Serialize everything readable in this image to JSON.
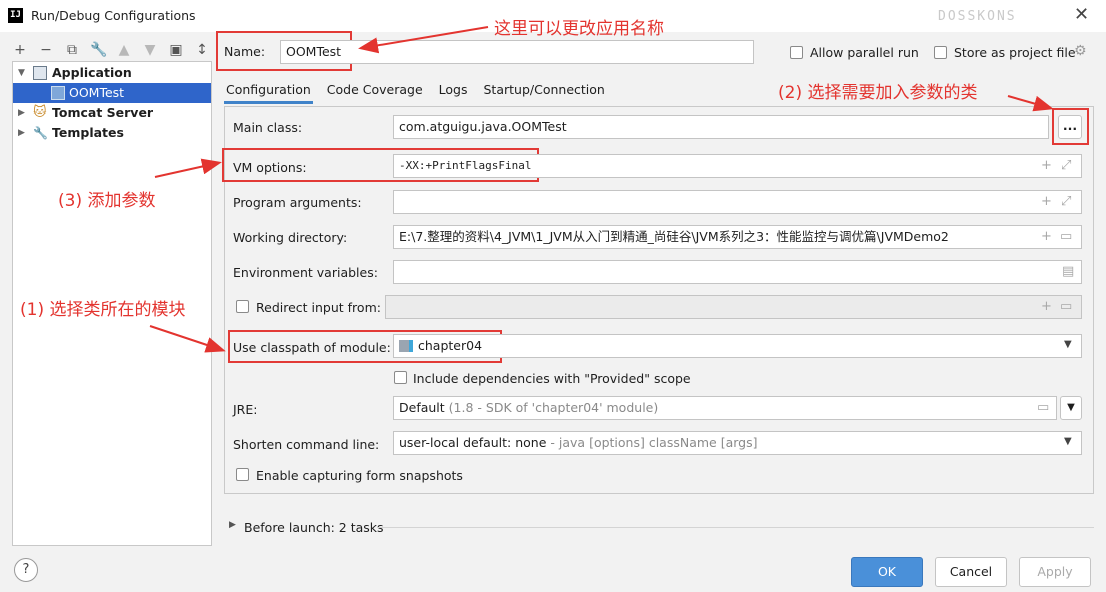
{
  "window": {
    "title": "Run/Debug Configurations",
    "app_icon_text": "IJ",
    "watermark_top": "DOSSKONS"
  },
  "tree": {
    "application": "Application",
    "oomtest": "OOMTest",
    "tomcat": "Tomcat Server",
    "templates": "Templates"
  },
  "form": {
    "name_label": "Name:",
    "name_value": "OOMTest",
    "allow_parallel": "Allow parallel run",
    "store_project": "Store as project file",
    "tabs": [
      "Configuration",
      "Code Coverage",
      "Logs",
      "Startup/Connection"
    ],
    "main_class_label": "Main class:",
    "main_class_value": "com.atguigu.java.OOMTest",
    "browse_label": "...",
    "vm_label": "VM options:",
    "vm_value": "-XX:+PrintFlagsFinal",
    "prog_args_label": "Program arguments:",
    "working_dir_label": "Working directory:",
    "working_dir_value": "E:\\7.整理的资料\\4_JVM\\1_JVM从入门到精通_尚硅谷\\JVM系列之3：性能监控与调优篇\\JVMDemo2",
    "env_label": "Environment variables:",
    "redirect_label": "Redirect input from:",
    "classpath_label": "Use classpath of module:",
    "classpath_value": "chapter04",
    "include_deps": "Include dependencies with \"Provided\" scope",
    "jre_label": "JRE:",
    "jre_value": "Default",
    "jre_hint": "(1.8 - SDK of 'chapter04' module)",
    "shorten_label": "Shorten command line:",
    "shorten_value": "user-local default: none",
    "shorten_hint": "- java [options] className [args]",
    "form_snapshots": "Enable capturing form snapshots",
    "before_launch": "Before launch: 2 tasks"
  },
  "annotations": {
    "rename": "这里可以更改应用名称",
    "step2": "(2)  选择需要加入参数的类",
    "step3": "(3)  添加参数",
    "step1": "(1) 选择类所在的模块"
  },
  "buttons": {
    "ok": "OK",
    "cancel": "Cancel",
    "apply": "Apply",
    "help": "?"
  },
  "colors": {
    "accent": "#2f65ca",
    "annotation": "#e3342f",
    "tab_underline": "#4083c9"
  }
}
